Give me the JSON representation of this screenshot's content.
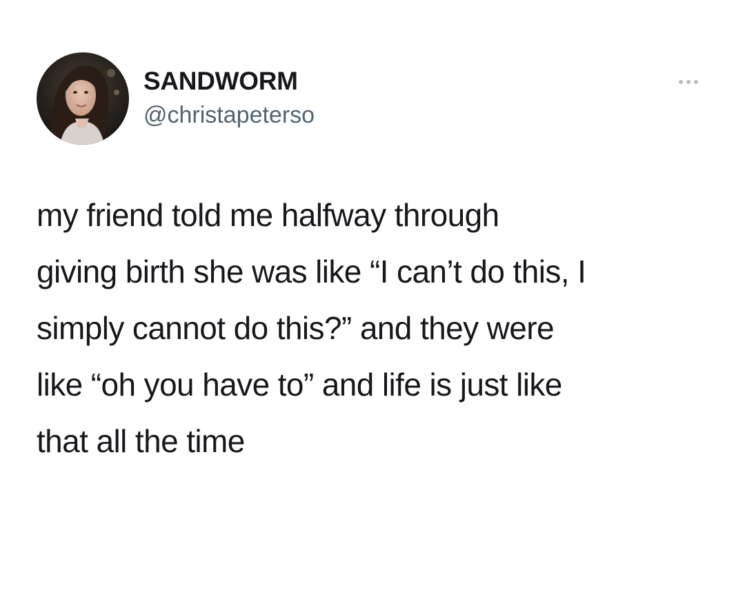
{
  "tweet": {
    "author": {
      "display_name": "SANDWORM",
      "handle": "@christapeterso"
    },
    "more_icon": "more-horizontal-icon",
    "text": "my friend told me halfway through\ngiving birth she was like “I can’t do this, I\nsimply cannot do this?” and they were\nlike “oh you have to” and life is just like\nthat all the time"
  }
}
